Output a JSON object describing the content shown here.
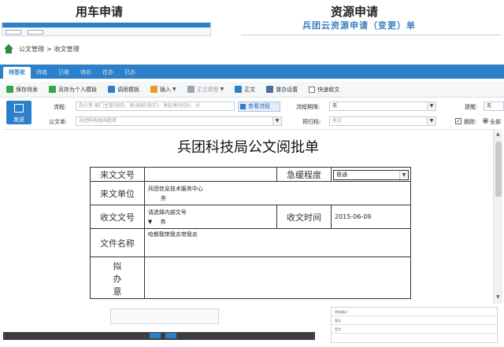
{
  "header": {
    "left_title": "用车申请",
    "right_title": "资源申请",
    "right_subtitle": "兵团云资源申请（变更）单"
  },
  "breadcrumb": {
    "items": [
      "公文管理",
      ">",
      "收文管理"
    ]
  },
  "tabs": [
    {
      "label": "待签收",
      "active": true
    },
    {
      "label": "待收"
    },
    {
      "label": "已收"
    },
    {
      "label": "待办"
    },
    {
      "label": "在办"
    },
    {
      "label": "已办"
    }
  ],
  "toolbar": {
    "save_pending": "保存待发",
    "save_as_template": "另存为个人模板",
    "use_template": "调用模板",
    "insert": "插入",
    "doc_type": "正文类型",
    "body": "正文",
    "settings": "督办设置",
    "quick_receive": "快速收文"
  },
  "form": {
    "send_label": "发送",
    "flow_label": "流程:",
    "flow_placeholder": "办公室-部门主管(协办、阅/阅知(批示)、发起者(协办)、分",
    "view_flow": "查看流程",
    "flow_deadline_label": "流程期限:",
    "flow_deadline_value": "无",
    "remind_label": "提醒:",
    "remind_value": "无",
    "doc_form_label": "公文单:",
    "doc_form_value": "兵团科技局阅批单",
    "archive_label": "预归档:",
    "archive_value": "收文",
    "track_label": "跟踪:",
    "all_label": "全部"
  },
  "document": {
    "title": "兵团科技局公文阅批单",
    "rows": {
      "incoming_no": "来文文号",
      "urgency": "急缓程度",
      "urgency_value": "普通",
      "incoming_unit": "来文单位",
      "incoming_unit_value": "兵团信息技术服务中心",
      "incoming_unit_mark": "务",
      "receive_no": "收文文号",
      "receive_no_value": "请选择内部文号",
      "receive_no_mark": "务",
      "receive_time": "收文时间",
      "receive_time_value": "2015-06-09",
      "file_name": "文件名称",
      "file_name_value": "哈都我带我去带我去",
      "draft_label_1": "拟",
      "draft_label_2": "办",
      "draft_label_3": "意"
    }
  },
  "bottom_right": {
    "rows": [
      "审核情况",
      "意见",
      "签字"
    ]
  }
}
